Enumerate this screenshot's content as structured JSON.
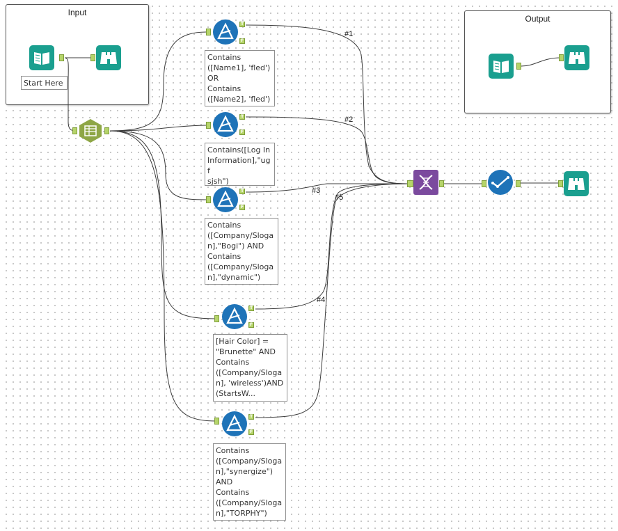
{
  "containers": {
    "input": {
      "title": "Input"
    },
    "output": {
      "title": "Output"
    }
  },
  "tools": {
    "input_data": {
      "icon": "book-open-icon",
      "annotation": "Start Here"
    },
    "browse_input": {
      "icon": "binoculars-icon"
    },
    "select": {
      "icon": "select-records-icon"
    },
    "filter1": {
      "icon": "filter-icon",
      "annotation": "Contains\n([Name1], 'fled')\nOR\nContains\n([Name2], 'fled')"
    },
    "filter2": {
      "icon": "filter-icon",
      "annotation": "Contains([Log In\nInformation],\"ugf\nsjsh\")"
    },
    "filter3": {
      "icon": "filter-icon",
      "annotation": "Contains\n([Company/Sloga\nn],\"Bogi\") AND\nContains\n([Company/Sloga\nn],\"dynamic\")"
    },
    "filter4": {
      "icon": "filter-icon",
      "annotation": "[Hair Color] =\n\"Brunette\" AND\nContains\n([Company/Sloga\nn], 'wireless')AND\n(StartsW..."
    },
    "filter5": {
      "icon": "filter-icon",
      "annotation": "Contains\n([Company/Sloga\nn],\"synergize\")\nAND\nContains\n([Company/Sloga\nn],\"TORPHY\")"
    },
    "union": {
      "icon": "dna-union-icon"
    },
    "check": {
      "icon": "checkmark-flow-icon"
    },
    "browse_final": {
      "icon": "binoculars-icon"
    },
    "output_input": {
      "icon": "book-open-icon"
    },
    "output_browse": {
      "icon": "binoculars-icon"
    }
  },
  "anchors": {
    "true_label": "T",
    "false_label": "F"
  },
  "wire_labels": {
    "w1": "#1",
    "w2": "#2",
    "w3": "#3",
    "w4": "#4",
    "w5": "#5"
  },
  "colors": {
    "teal": "#1a9f8f",
    "filter_blue": "#1e73b8",
    "union_purple": "#7b4a9e",
    "select_green": "#8ea646",
    "anchor_green": "#b5d46a"
  }
}
